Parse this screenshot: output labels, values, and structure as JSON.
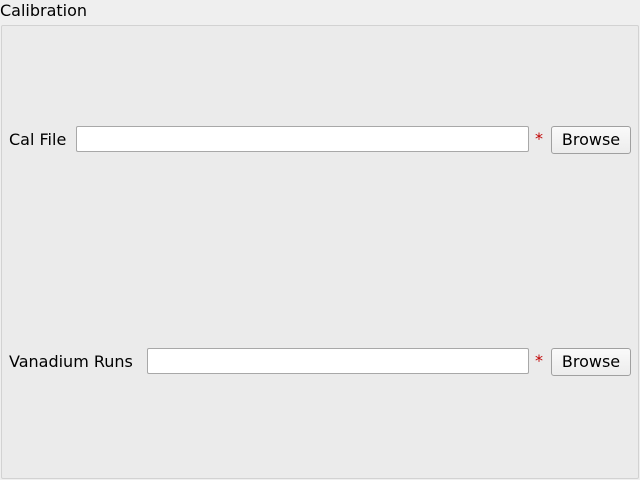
{
  "group": {
    "title": "Calibration"
  },
  "fields": {
    "cal_file": {
      "label": "Cal File",
      "value": "",
      "required_mark": "*",
      "browse_label": "Browse"
    },
    "vanadium_runs": {
      "label": "Vanadium Runs",
      "value": "",
      "required_mark": "*",
      "browse_label": "Browse"
    }
  },
  "colors": {
    "required_mark": "#c00000",
    "panel_background": "#ebebeb",
    "window_background": "#efefef"
  }
}
